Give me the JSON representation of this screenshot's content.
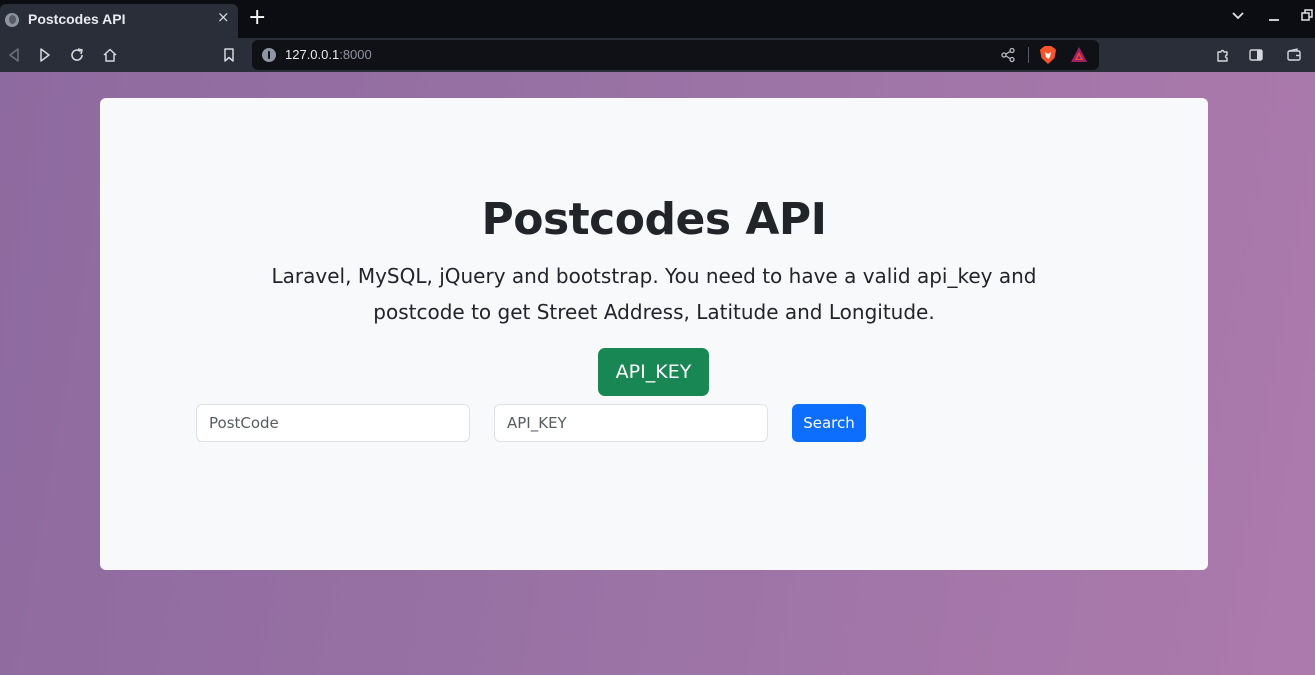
{
  "browser": {
    "tab": {
      "title": "Postcodes API",
      "close_glyph": "×"
    },
    "new_tab_glyph": "+",
    "window_controls": {
      "dropdown": "⌄",
      "minimize": "–",
      "restore": "⧉"
    },
    "url": {
      "host": "127.0.0.1",
      "port": ":8000"
    },
    "icons": [
      "globe-favicon-icon",
      "back-icon",
      "forward-icon",
      "reload-icon",
      "home-icon",
      "bookmark-icon",
      "site-info-icon",
      "share-icon",
      "brave-shields-icon",
      "brave-rewards-icon",
      "extensions-icon",
      "sidebar-icon",
      "wallet-icon"
    ]
  },
  "page": {
    "title": "Postcodes API",
    "description": "Laravel, MySQL, jQuery and bootstrap. You need to have a valid api_key and postcode to get Street Address, Latitude and Longitude.",
    "api_key_button": "API_KEY",
    "postcode_input": {
      "placeholder": "PostCode",
      "value": ""
    },
    "api_key_input": {
      "placeholder": "API_KEY",
      "value": ""
    },
    "search_button": "Search"
  },
  "colors": {
    "background_gradient": [
      "#8d6a9f",
      "#ad7aad"
    ],
    "card": "#f8f9fa",
    "success_button": "#198754",
    "primary_button": "#0d6efd",
    "text": "#212529"
  }
}
